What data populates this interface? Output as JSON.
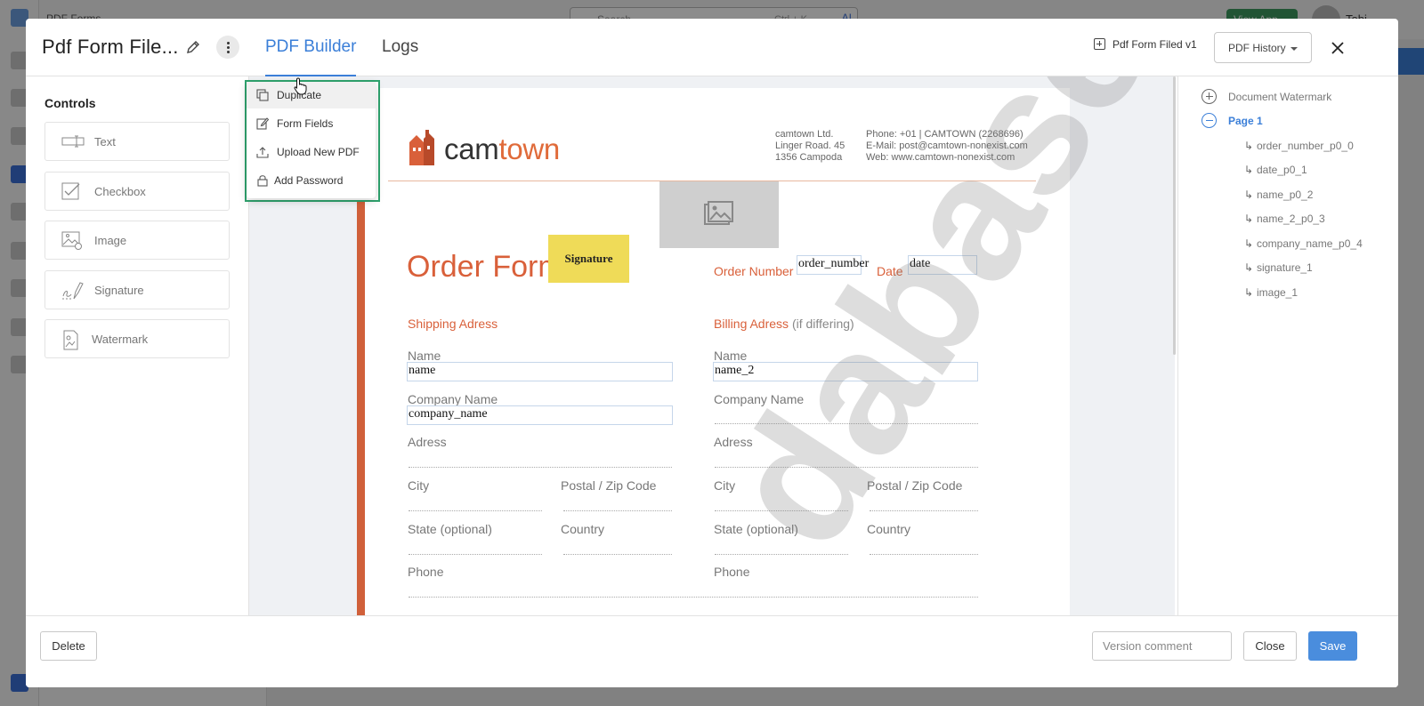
{
  "background": {
    "breadcrumb": "PDF Forms",
    "search_placeholder": "Search",
    "search_shortcut": "Ctrl + K",
    "search_ai": "AI",
    "view_app": "View App",
    "user_name": "Tobi"
  },
  "header": {
    "title": "Pdf Form File...",
    "tabs": [
      {
        "label": "PDF Builder",
        "active": true
      },
      {
        "label": "Logs",
        "active": false
      }
    ],
    "document_label": "Pdf Form Filed v1",
    "history_button": "PDF History"
  },
  "menu": {
    "items": [
      {
        "label": "Duplicate",
        "icon": "copy-icon",
        "hovered": true
      },
      {
        "label": "Form Fields",
        "icon": "edit-icon"
      },
      {
        "label": "Upload New PDF",
        "icon": "upload-icon"
      },
      {
        "label": "Add Password",
        "icon": "lock-icon"
      }
    ]
  },
  "controls": {
    "title": "Controls",
    "items": [
      {
        "label": "Text",
        "icon": "text-field-icon"
      },
      {
        "label": "Checkbox",
        "icon": "checkbox-icon"
      },
      {
        "label": "Image",
        "icon": "image-icon"
      },
      {
        "label": "Signature",
        "icon": "signature-icon"
      },
      {
        "label": "Watermark",
        "icon": "watermark-icon"
      }
    ]
  },
  "pdf": {
    "logo_text_a": "cam",
    "logo_text_b": "town",
    "company_address": "camtown Ltd.\nLinger Road. 45\n1356 Campoda",
    "company_contact": "Phone: +01 | CAMTOWN (2268696)\nE-Mail: post@camtown-nonexist.com\nWeb: www.camtown-nonexist.com",
    "order_form_title": "Order Form",
    "signature_field": "Signature",
    "order_number_label": "Order Number",
    "order_number_field": "order_number",
    "date_label": "Date",
    "date_field": "date",
    "shipping_title": "Shipping Adress",
    "billing_title": "Billing Adress",
    "billing_note": "(if differing)",
    "name_label": "Name",
    "name_field": "name",
    "name2_field": "name_2",
    "company_label": "Company Name",
    "company_field": "company_name",
    "adress_label": "Adress",
    "city_label": "City",
    "zip_label": "Postal / Zip Code",
    "state_label": "State (optional)",
    "country_label": "Country",
    "phone_label": "Phone",
    "watermark_text": "dabase"
  },
  "tree": {
    "root": "Document Watermark",
    "page": "Page 1",
    "children": [
      "order_number_p0_0",
      "date_p0_1",
      "name_p0_2",
      "name_2_p0_3",
      "company_name_p0_4",
      "signature_1",
      "image_1"
    ]
  },
  "footer": {
    "delete": "Delete",
    "version_placeholder": "Version comment",
    "close": "Close",
    "save": "Save"
  },
  "colors": {
    "accent": "#3b7fd8",
    "brand_orange": "#d9603a",
    "menu_highlight": "#2fa36e",
    "signature_fill": "#efdb58"
  }
}
